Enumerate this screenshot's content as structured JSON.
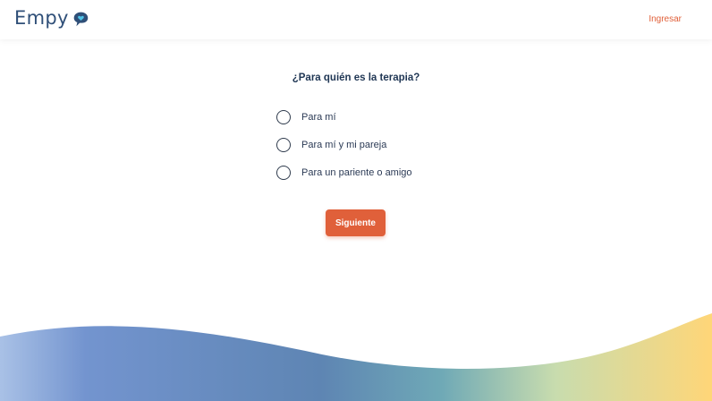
{
  "header": {
    "logo_text": "Empy",
    "login_label": "Ingresar"
  },
  "form": {
    "question": "¿Para quién es la terapia?",
    "options": [
      {
        "label": "Para mí",
        "selected": false
      },
      {
        "label": "Para mí y mi pareja",
        "selected": false
      },
      {
        "label": "Para un pariente o amigo",
        "selected": false
      }
    ],
    "next_label": "Siguiente"
  },
  "colors": {
    "brand_blue": "#2f4f78",
    "accent_orange": "#e0603a",
    "text_dark": "#1f3654"
  }
}
